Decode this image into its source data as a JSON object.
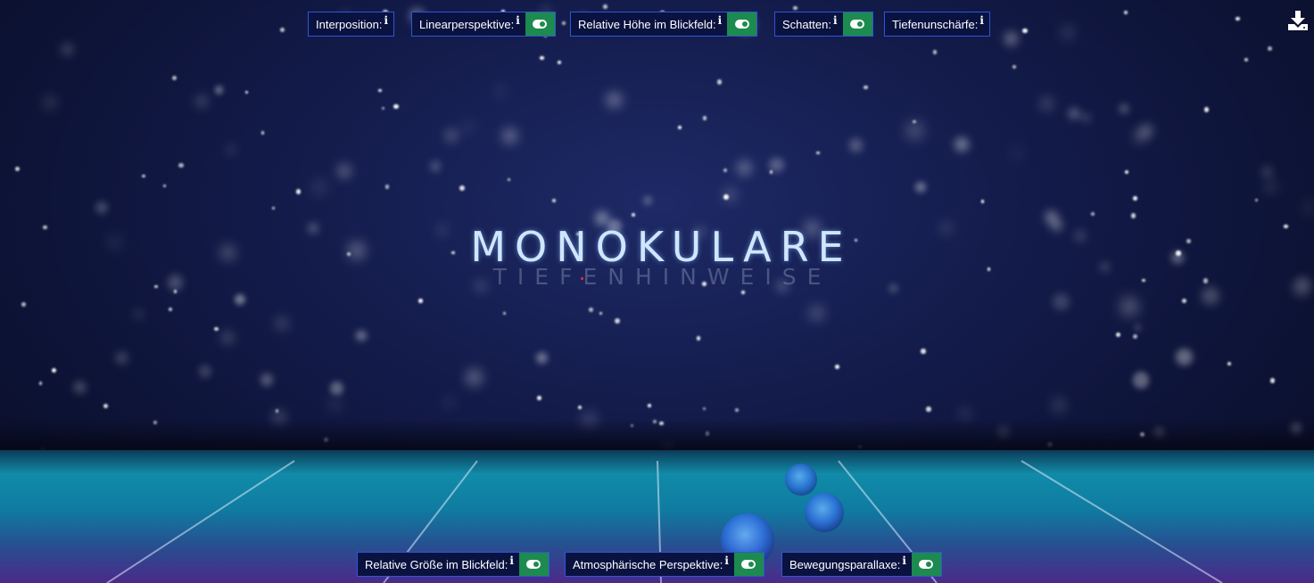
{
  "title": "MONOKULARE",
  "subtitle": "TIEFENHINWEISE",
  "info_glyph": "i",
  "download": {
    "icon": "download-icon"
  },
  "top_controls": [
    {
      "label": "Interposition:",
      "toggle": false
    },
    {
      "label": "Linearperspektive:",
      "toggle": true,
      "on": true
    },
    {
      "label": "Relative Höhe im Blickfeld:",
      "toggle": true,
      "on": true
    },
    {
      "label": "Schatten:",
      "toggle": true,
      "on": true
    },
    {
      "label": "Tiefenunschärfe:",
      "toggle": false
    }
  ],
  "bottom_controls": [
    {
      "label": "Relative Größe im Blickfeld:",
      "toggle": true,
      "on": true
    },
    {
      "label": "Atmosphärische Perspektive:",
      "toggle": true,
      "on": true
    },
    {
      "label": "Bewegungsparallaxe:",
      "toggle": true,
      "on": true
    }
  ],
  "colors": {
    "toggle_on": "#1d8a4f",
    "control_border": "#2f56d6",
    "control_bg": "#0a1240"
  }
}
